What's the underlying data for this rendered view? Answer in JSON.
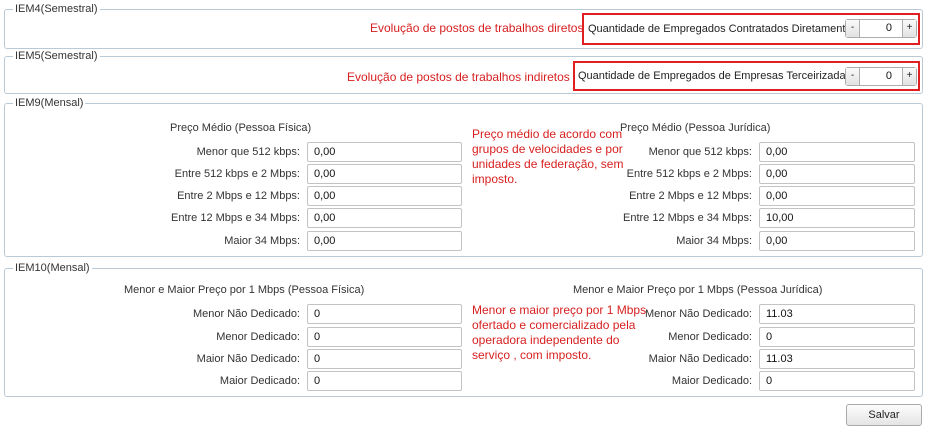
{
  "iem4": {
    "legend": "IEM4(Semestral)",
    "note": "Evolução de postos de trabalhos diretos",
    "label": "Quantidade de Empregados Contratados Diretamente:",
    "value": "0"
  },
  "iem5": {
    "legend": "IEM5(Semestral)",
    "note": "Evolução de postos de trabalhos indiretos",
    "label": "Quantidade de Empregados de Empresas Terceirizadas:",
    "value": "0"
  },
  "stepper": {
    "minus": "-",
    "plus": "+"
  },
  "iem9": {
    "legend": "IEM9(Mensal)",
    "pf_title": "Preço Médio (Pessoa Física)",
    "pj_title": "Preço Médio (Pessoa Jurídica)",
    "note_lines": [
      "Preço médio de acordo com",
      "grupos de velocidades e por",
      "unidades de federação, sem",
      "imposto."
    ],
    "rows": [
      {
        "label": "Menor que 512 kbps:",
        "pf": "0,00",
        "pj": "0,00"
      },
      {
        "label": "Entre 512 kbps e 2 Mbps:",
        "pf": "0,00",
        "pj": "0,00"
      },
      {
        "label": "Entre 2 Mbps e 12 Mbps:",
        "pf": "0,00",
        "pj": "0,00"
      },
      {
        "label": "Entre 12 Mbps e 34 Mbps:",
        "pf": "0,00",
        "pj": "10,00"
      },
      {
        "label": "Maior 34 Mbps:",
        "pf": "0,00",
        "pj": "0,00"
      }
    ]
  },
  "iem10": {
    "legend": "IEM10(Mensal)",
    "pf_title": "Menor e Maior Preço por 1 Mbps (Pessoa Física)",
    "pj_title": "Menor e Maior Preço por 1 Mbps (Pessoa Jurídica)",
    "note_lines": [
      "Menor e maior preço por 1 Mbps",
      "ofertado e comercializado pela",
      "operadora independente do",
      "serviço , com imposto."
    ],
    "rows": [
      {
        "label": "Menor Não Dedicado:",
        "pf": "0",
        "pj": "11.03"
      },
      {
        "label": "Menor Dedicado:",
        "pf": "0",
        "pj": "0"
      },
      {
        "label": "Maior Não Dedicado:",
        "pf": "0",
        "pj": "11.03"
      },
      {
        "label": "Maior Dedicado:",
        "pf": "0",
        "pj": "0"
      }
    ]
  },
  "save_label": "Salvar"
}
